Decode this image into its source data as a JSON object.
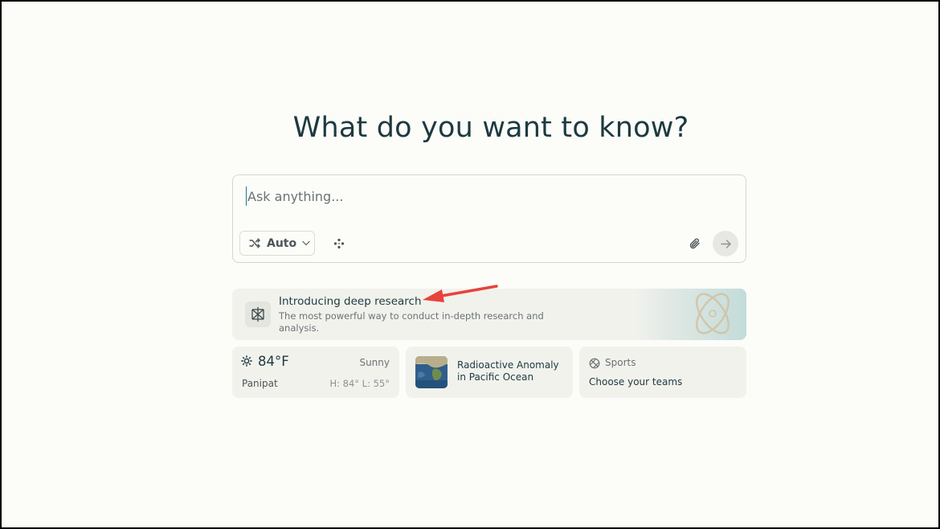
{
  "main": {
    "heading": "What do you want to know?"
  },
  "search": {
    "placeholder": "Ask anything...",
    "mode_label": "Auto"
  },
  "banner": {
    "title": "Introducing deep research",
    "description": "The most powerful way to conduct in-depth research and analysis."
  },
  "weather": {
    "temperature": "84°F",
    "condition": "Sunny",
    "city": "Panipat",
    "hilo": "H: 84° L: 55°"
  },
  "news": {
    "title": "Radioactive Anomaly in Pacific Ocean"
  },
  "sports": {
    "label": "Sports",
    "subtitle": "Choose your teams"
  },
  "colors": {
    "background": "#fcfcf9",
    "card": "#f2f2ed",
    "text": "#13343b",
    "annotation_arrow": "#e8423b"
  },
  "icons": {
    "mode": "shuffle-icon",
    "focus": "focus-icon",
    "attach": "paperclip-icon",
    "submit": "arrow-right-icon",
    "banner": "deep-research-icon",
    "weather": "sun-icon",
    "sports": "basketball-icon"
  }
}
